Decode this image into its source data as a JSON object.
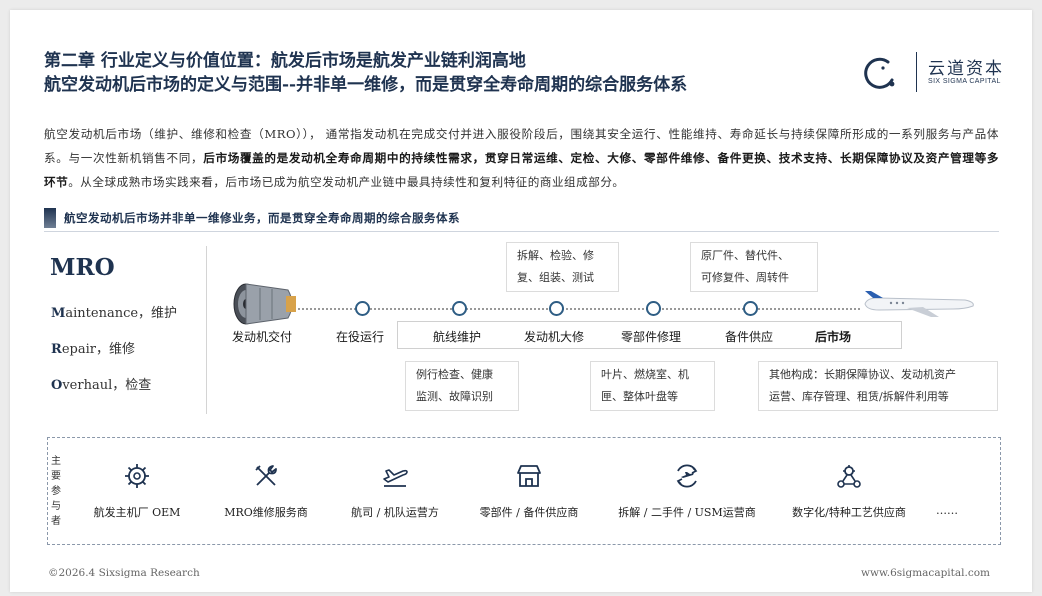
{
  "header": {
    "title_line1": "第二章 行业定义与价值位置：航发后市场是航发产业链利润高地",
    "title_line2": "航空发动机后市场的定义与范围--并非单一维修，而是贯穿全寿命周期的综合服务体系"
  },
  "logo": {
    "cn": "云道资本",
    "en": "SIX SIGMA CAPITAL"
  },
  "intro": {
    "p1": "航空发动机后市场（维护、维修和检查（MRO））， 通常指发动机在完成交付并进入服役阶段后，围绕其安全运行、性能维持、寿命延长与持续保障所形成的一系列服务与产品体系。与一次性新机销售不同，",
    "p2_bold": "后市场覆盖的是发动机全寿命周期中的持续性需求，贯穿日常运维、定检、大修、零部件维修、备件更换、技术支持、长期保障协议及资产管理等多环节",
    "p3": "。从全球成熟市场实践来看，后市场已成为航空发动机产业链中最具持续性和复利特征的商业组成部分。"
  },
  "section": {
    "title": "航空发动机后市场并非单一维修业务，而是贯穿全寿命周期的综合服务体系"
  },
  "mro": {
    "title": "MRO",
    "items": [
      {
        "cap": "M",
        "rest": "aintenance，维护"
      },
      {
        "cap": "R",
        "rest": "epair，维修"
      },
      {
        "cap": "O",
        "rest": "verhaul，检查"
      }
    ]
  },
  "timeline": {
    "stages": [
      "发动机交付",
      "在役运行",
      "航线维护",
      "发动机大修",
      "零部件修理",
      "备件供应",
      "后市场"
    ],
    "notes_top": [
      {
        "line1": "拆解、检验、修",
        "line2": "复、组装、测试"
      },
      {
        "line1": "原厂件、替代件、",
        "line2": "可修复件、周转件"
      }
    ],
    "notes_bottom": [
      {
        "line1": "例行检查、健康",
        "line2": "监测、故障识别"
      },
      {
        "line1": "叶片、燃烧室、机",
        "line2": "匣、整体叶盘等"
      },
      {
        "line1": "其他构成：长期保障协议、发动机资产",
        "line2": "运营、库存管理、租赁/拆解件利用等"
      }
    ]
  },
  "participants": {
    "label": "主要参与者",
    "items": [
      {
        "label": "航发主机厂 OEM",
        "icon": "engine-gear-icon"
      },
      {
        "label": "MRO维修服务商",
        "icon": "tools-icon"
      },
      {
        "label": "航司 / 机队运营方",
        "icon": "plane-takeoff-icon"
      },
      {
        "label": "零部件 / 备件供应商",
        "icon": "store-icon"
      },
      {
        "label": "拆解 / 二手件 / USM运营商",
        "icon": "recycle-plane-icon"
      },
      {
        "label": "数字化/特种工艺供应商",
        "icon": "network-gear-icon"
      }
    ],
    "more": "……"
  },
  "footer": {
    "left": "©2026.4 Sixsigma Research",
    "right": "www.6sigmacapital.com"
  },
  "colors": {
    "navy": "#1f3350",
    "accent": "#2e5d84"
  }
}
